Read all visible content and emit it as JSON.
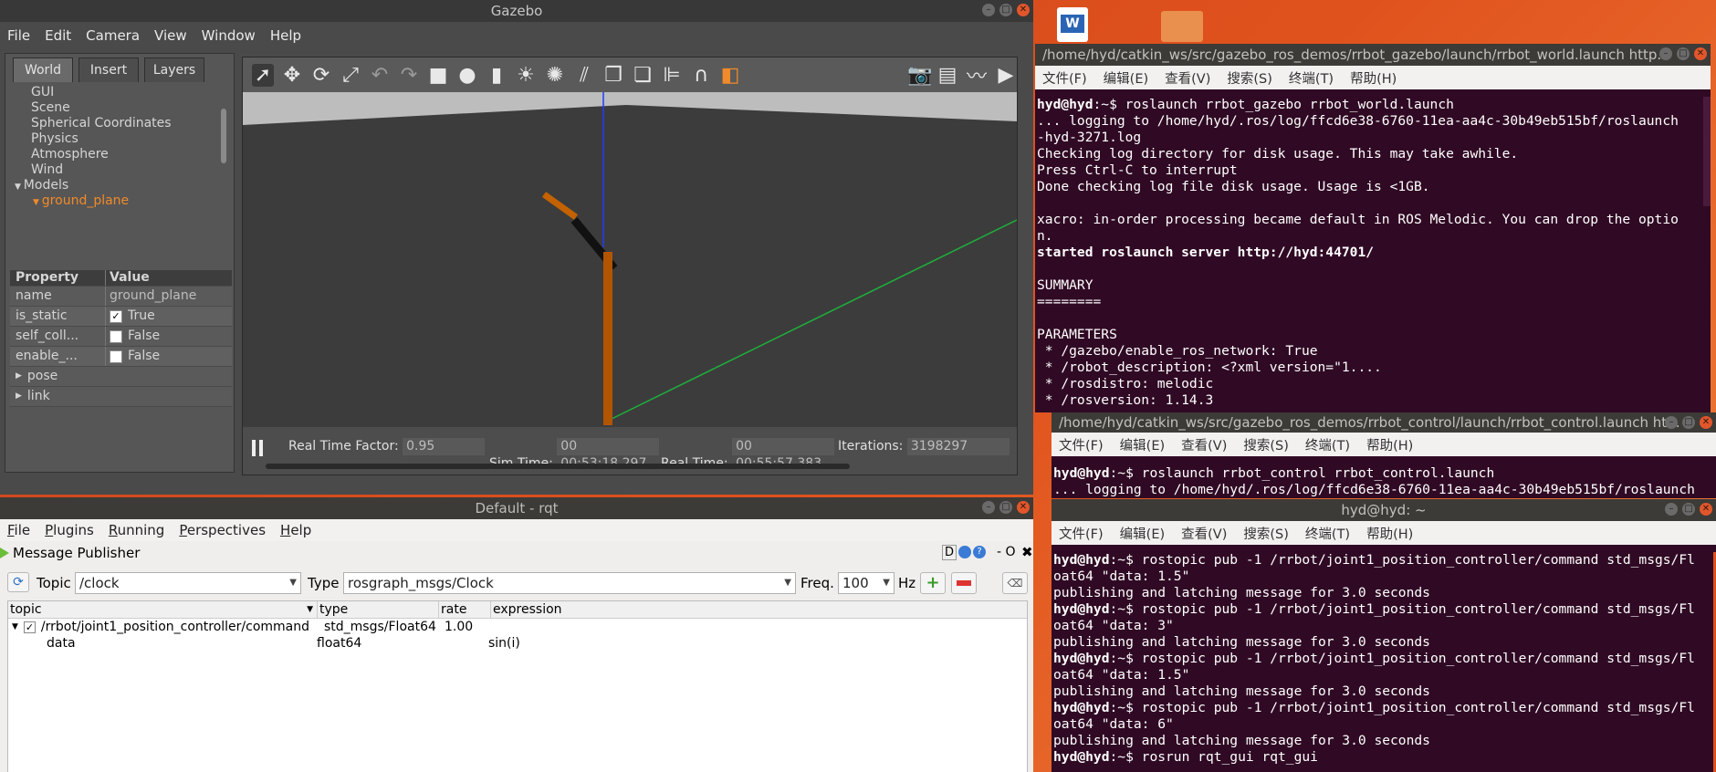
{
  "gazebo": {
    "title": "Gazebo",
    "menu": [
      "File",
      "Edit",
      "Camera",
      "View",
      "Window",
      "Help"
    ],
    "tabs": [
      "World",
      "Insert",
      "Layers"
    ],
    "tree": [
      "GUI",
      "Scene",
      "Spherical Coordinates",
      "Physics",
      "Atmosphere",
      "Wind"
    ],
    "models_label": "Models",
    "selected_model": "ground_plane",
    "prop_header": {
      "property": "Property",
      "value": "Value"
    },
    "props": [
      {
        "name": "name",
        "value": "ground_plane",
        "checkbox": false
      },
      {
        "name": "is_static",
        "value": "True",
        "checkbox": true,
        "checked": true
      },
      {
        "name": "self_coll...",
        "value": "False",
        "checkbox": true,
        "checked": false
      },
      {
        "name": "enable_...",
        "value": "False",
        "checkbox": true,
        "checked": false
      }
    ],
    "expand": [
      "pose",
      "link"
    ],
    "status": {
      "rtf_label": "Real Time Factor:",
      "rtf": "0.95",
      "sim_label": "Sim Time:",
      "sim": "00 00:53:18.297",
      "real_label": "Real Time:",
      "real": "00 00:55:57.383",
      "iter_label": "Iterations:",
      "iter": "3198297"
    }
  },
  "desktop": {
    "accent": "#e0521d"
  },
  "rqt": {
    "title": "Default - rqt",
    "menu": [
      {
        "u": "F",
        "rest": "ile"
      },
      {
        "u": "P",
        "rest": "lugins"
      },
      {
        "u": "R",
        "rest": "unning"
      },
      {
        "u": "P",
        "rest": "erspectives"
      },
      {
        "u": "H",
        "rest": "elp"
      }
    ],
    "plugin_title": "Message Publisher",
    "plugin_controls": "D",
    "plugin_close": "- O",
    "topic_label": "Topic",
    "topic_value": "/clock",
    "type_label": "Type",
    "type_value": "rosgraph_msgs/Clock",
    "freq_label": "Freq.",
    "freq_value": "100",
    "hz_label": "Hz",
    "columns": [
      "topic",
      "type",
      "rate",
      "expression"
    ],
    "rows": [
      {
        "topic": "/rrbot/joint1_position_controller/command",
        "type": "std_msgs/Float64",
        "rate": "1.00",
        "expression": ""
      },
      {
        "topic": "data",
        "type": "float64",
        "rate": "",
        "expression": "sin(i)"
      }
    ]
  },
  "term_menu": [
    "文件(F)",
    "编辑(E)",
    "查看(V)",
    "搜索(S)",
    "终端(T)",
    "帮助(H)"
  ],
  "term1": {
    "title": "/home/hyd/catkin_ws/src/gazebo_ros_demos/rrbot_gazebo/launch/rrbot_world.launch http...",
    "prompt": "hyd@hyd",
    "lines": [
      {
        "p": true,
        "text": ":~$ roslaunch rrbot_gazebo rrbot_world.launch"
      },
      {
        "text": "... logging to /home/hyd/.ros/log/ffcd6e38-6760-11ea-aa4c-30b49eb515bf/roslaunch"
      },
      {
        "text": "-hyd-3271.log"
      },
      {
        "text": "Checking log directory for disk usage. This may take awhile."
      },
      {
        "text": "Press Ctrl-C to interrupt"
      },
      {
        "text": "Done checking log file disk usage. Usage is <1GB."
      },
      {
        "text": ""
      },
      {
        "text": "xacro: in-order processing became default in ROS Melodic. You can drop the optio"
      },
      {
        "text": "n."
      },
      {
        "b": true,
        "text": "started roslaunch server http://hyd:44701/"
      },
      {
        "text": ""
      },
      {
        "text": "SUMMARY"
      },
      {
        "text": "========"
      },
      {
        "text": ""
      },
      {
        "text": "PARAMETERS"
      },
      {
        "text": " * /gazebo/enable_ros_network: True"
      },
      {
        "text": " * /robot_description: <?xml version=\"1...."
      },
      {
        "text": " * /rosdistro: melodic"
      },
      {
        "text": " * /rosversion: 1.14.3"
      }
    ]
  },
  "term2": {
    "title": "/home/hyd/catkin_ws/src/gazebo_ros_demos/rrbot_control/launch/rrbot_control.launch ht...",
    "lines": [
      {
        "p": true,
        "text": ":~$ roslaunch rrbot_control rrbot_control.launch"
      },
      {
        "text": "... logging to /home/hyd/.ros/log/ffcd6e38-6760-11ea-aa4c-30b49eb515bf/roslaunch"
      }
    ]
  },
  "term3": {
    "title": "hyd@hyd: ~",
    "lines": [
      {
        "p": true,
        "text": ":~$ rostopic pub -1 /rrbot/joint1_position_controller/command std_msgs/Fl"
      },
      {
        "text": "oat64 \"data: 1.5\""
      },
      {
        "text": "publishing and latching message for 3.0 seconds"
      },
      {
        "p": true,
        "text": ":~$ rostopic pub -1 /rrbot/joint1_position_controller/command std_msgs/Fl"
      },
      {
        "text": "oat64 \"data: 3\""
      },
      {
        "text": "publishing and latching message for 3.0 seconds"
      },
      {
        "p": true,
        "text": ":~$ rostopic pub -1 /rrbot/joint1_position_controller/command std_msgs/Fl"
      },
      {
        "text": "oat64 \"data: 1.5\""
      },
      {
        "text": "publishing and latching message for 3.0 seconds"
      },
      {
        "p": true,
        "text": ":~$ rostopic pub -1 /rrbot/joint1_position_controller/command std_msgs/Fl"
      },
      {
        "text": "oat64 \"data: 6\""
      },
      {
        "text": "publishing and latching message for 3.0 seconds"
      },
      {
        "p": true,
        "text": ":~$ rosrun rqt_gui rqt_gui"
      }
    ]
  }
}
